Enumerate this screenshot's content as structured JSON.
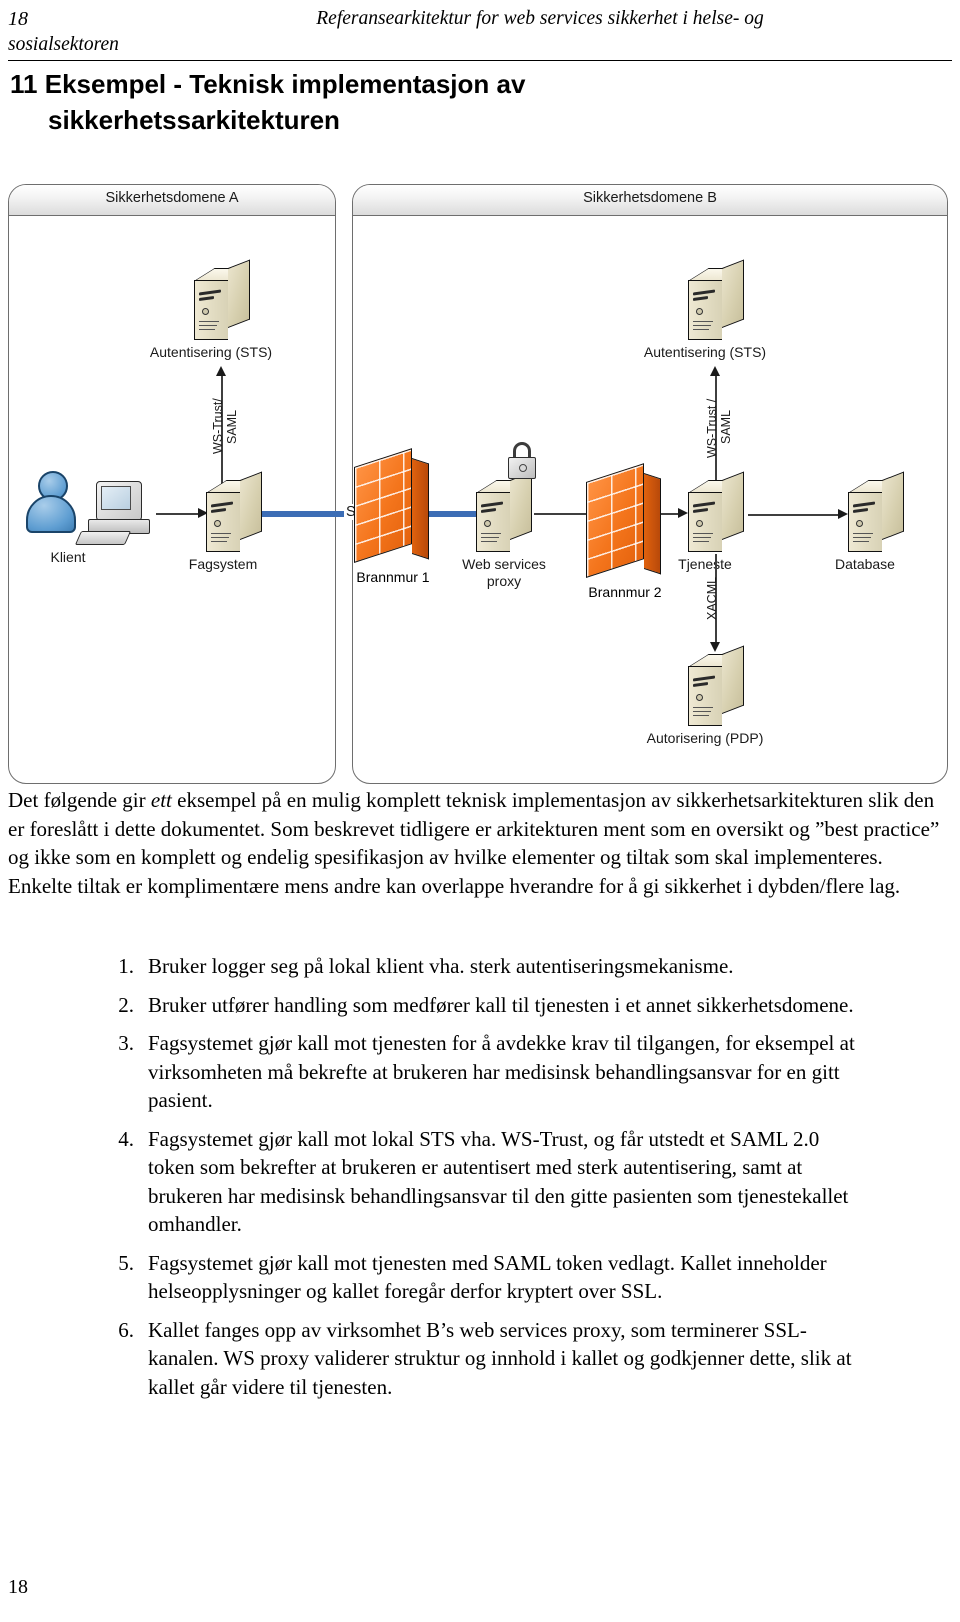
{
  "header": {
    "page_number": "18",
    "title_line1": "Referansearkitektur for web services sikkerhet i helse- og",
    "title_line2": "sosialsektoren"
  },
  "chapter": {
    "number": "11",
    "title_line1": "Eksempel - Teknisk implementasjon av",
    "title_line2": "sikkerhetssarkitekturen",
    "full_title": "11 Eksempel - Teknisk implementasjon av sikkerhetssarkitekturen"
  },
  "diagram": {
    "domain_a_title": "Sikkerhetsdomene A",
    "domain_b_title": "Sikkerhetsdomene B",
    "nodes": {
      "sts_a": "Autentisering (STS)",
      "sts_b": "Autentisering (STS)",
      "klient": "Klient",
      "fagsystem": "Fagsystem",
      "brannmur1": "Brannmur 1",
      "ws_proxy_line1": "Web services",
      "ws_proxy_line2": "proxy",
      "brannmur2": "Brannmur 2",
      "tjeneste": "Tjeneste",
      "database": "Database",
      "pdp": "Autorisering (PDP)"
    },
    "connector_labels": {
      "ssl_tls": "SSL/TLS",
      "ws_trust_saml_a_line1": "WS-Trust/",
      "ws_trust_saml_a_line2": "SAML",
      "ws_trust_saml_b_line1": "WS-Trust /",
      "ws_trust_saml_b_line2": "SAML",
      "xacml": "XACML"
    },
    "colors": {
      "firewall_orange": "#f4751c",
      "ssl_blue": "#3c6db5",
      "server_beige": "#e2dcc2",
      "person_blue": "#5f9ed2",
      "domain_border": "#6e6e6e"
    }
  },
  "body": {
    "paragraph_part1": "Det følgende gir ",
    "paragraph_emphasis": "ett",
    "paragraph_part2": " eksempel på en mulig komplett teknisk implementasjon av sikkerhetsarkitekturen slik den er foreslått i dette dokumentet. Som beskrevet tidligere er arkitekturen ment som en oversikt og ”best practice” og ikke som en komplett og endelig spesifikasjon av hvilke elementer og tiltak som skal implementeres. Enkelte tiltak er komplimentære mens andre kan overlappe hverandre for å gi sikkerhet i dybden/flere lag."
  },
  "steps": [
    {
      "number": "1.",
      "text": "Bruker logger seg på lokal klient vha. sterk autentiseringsmekanisme."
    },
    {
      "number": "2.",
      "text": "Bruker utfører handling som medfører kall til tjenesten i et annet sikkerhetsdomene."
    },
    {
      "number": "3.",
      "text": "Fagsystemet gjør kall mot tjenesten for å avdekke krav til tilgangen, for eksempel at virksomheten må bekrefte at brukeren har medisinsk behandlingsansvar for en gitt pasient."
    },
    {
      "number": "4.",
      "text": "Fagsystemet gjør kall mot lokal STS vha. WS-Trust, og får utstedt et SAML 2.0 token som bekrefter at brukeren er autentisert med sterk autentisering, samt at brukeren har medisinsk behandlingsansvar til den gitte pasienten som tjenestekallet omhandler."
    },
    {
      "number": "5.",
      "text": "Fagsystemet gjør kall mot tjenesten med SAML token vedlagt. Kallet inneholder helseopplysninger og kallet foregår derfor kryptert over SSL."
    },
    {
      "number": "6.",
      "text": "Kallet fanges opp av virksomhet B’s web services proxy, som terminerer SSL-kanalen. WS proxy validerer struktur og innhold i kallet og godkjenner dette, slik at kallet går videre til tjenesten."
    }
  ],
  "footer": {
    "page_number": "18"
  }
}
